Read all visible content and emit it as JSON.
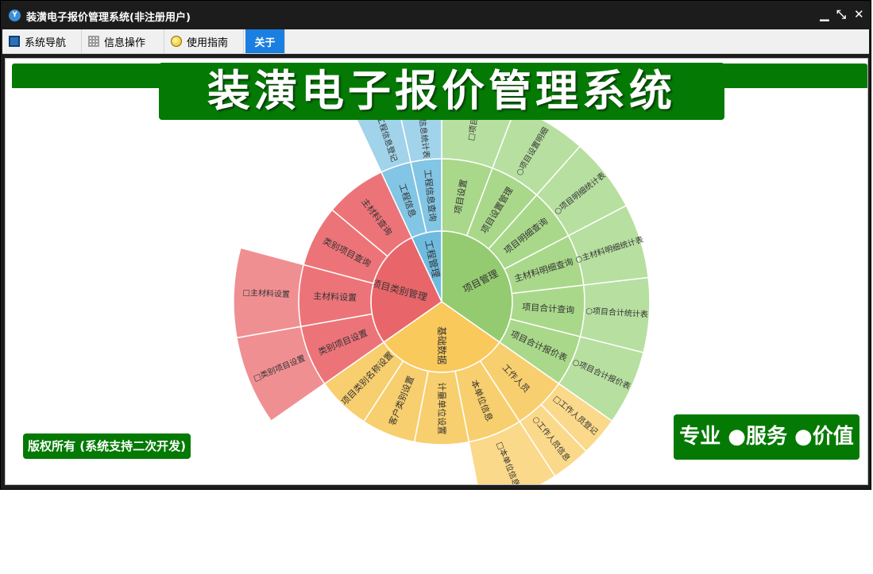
{
  "window": {
    "title": "装潢电子报价管理系统(非注册用户)",
    "icon": "app-logo-icon",
    "controls": {
      "minimize": "▁",
      "restore": "⤡",
      "close": "✕"
    }
  },
  "menu": {
    "tabs": [
      {
        "label": "系统导航",
        "icon": "monitor-icon"
      },
      {
        "label": "信息操作",
        "icon": "grid-icon"
      },
      {
        "label": "使用指南",
        "icon": "bulb-icon"
      },
      {
        "label": "关于",
        "active": true
      }
    ]
  },
  "banner": {
    "title": "装潢电子报价管理系统"
  },
  "footer": {
    "copyright": "版权所有 (系统支持二次开发)",
    "slogan": "专业 ●服务 ●价值"
  },
  "colors": {
    "brand_green": "#047a04",
    "titlebar": "#1c1c1c",
    "active_tab": "#1a7fe0",
    "green": "#95cb70",
    "blue": "#6fbbdf",
    "red": "#e8666a",
    "yellow": "#f9c95c"
  },
  "sunburst": {
    "center": "",
    "groups": [
      {
        "name": "项目管理",
        "color": "green",
        "start": -90,
        "end": 35,
        "children": [
          {
            "name": "项目设置",
            "leaf": [
              "□项目"
            ]
          },
          {
            "name": "项目设置管理",
            "leaf": [
              "○项目设置明细"
            ]
          },
          {
            "name": "项目明细查询",
            "leaf": [
              "○项目明细统计表"
            ]
          },
          {
            "name": "主材料明细查询",
            "leaf": [
              "○主材料明细统计表"
            ]
          },
          {
            "name": "项目合计查询",
            "leaf": [
              "○项目合计统计表"
            ]
          },
          {
            "name": "项目合计报价表",
            "leaf": [
              "○项目合计报价表"
            ]
          }
        ]
      },
      {
        "name": "基础数据",
        "color": "yellow",
        "start": 35,
        "end": 145,
        "children": [
          {
            "name": "工作人员",
            "leaf": [
              "□工作人员登记",
              "○工作人员信息"
            ]
          },
          {
            "name": "本单位信息",
            "leaf": [
              "□本单位信息"
            ]
          },
          {
            "name": "计量单位设置"
          },
          {
            "name": "客户类别设置"
          },
          {
            "name": "项目类别名称设置"
          }
        ]
      },
      {
        "name": "项目类别管理",
        "color": "red",
        "start": 145,
        "end": 245,
        "children": [
          {
            "name": "类别项目设置",
            "leaf": [
              "□类别项目设置"
            ]
          },
          {
            "name": "主材料设置",
            "leaf": [
              "□主材料设置"
            ]
          },
          {
            "name": "类别项目查询"
          },
          {
            "name": "主材料查询"
          }
        ]
      },
      {
        "name": "工程管理",
        "color": "blue",
        "start": 245,
        "end": 270,
        "children": [
          {
            "name": "工程信息",
            "leaf": [
              "□工程信息登记"
            ]
          },
          {
            "name": "工程信息查询",
            "leaf": [
              "○工程信息统计表"
            ]
          }
        ]
      }
    ]
  }
}
